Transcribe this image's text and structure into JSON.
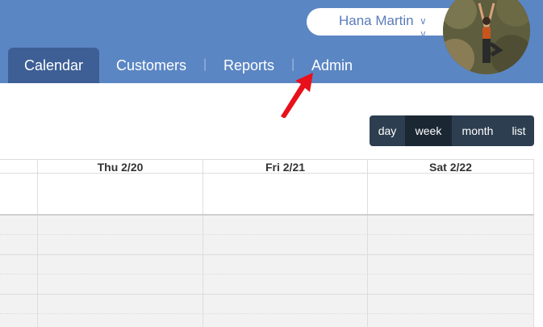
{
  "header": {
    "user_name": "Hana Martin",
    "user_menu_icon": "double-chevron-down-icon",
    "avatar": "profile-photo"
  },
  "nav": {
    "tabs": [
      {
        "label": "Calendar",
        "active": true
      },
      {
        "label": "Customers",
        "active": false
      },
      {
        "label": "Reports",
        "active": false
      },
      {
        "label": "Admin",
        "active": false
      }
    ],
    "separator": "|"
  },
  "view_switcher": {
    "buttons": [
      {
        "label": "day",
        "active": false
      },
      {
        "label": "week",
        "active": true
      },
      {
        "label": "month",
        "active": false
      },
      {
        "label": "list",
        "active": false
      }
    ]
  },
  "calendar": {
    "columns": [
      "Thu 2/20",
      "Fri 2/21",
      "Sat 2/22"
    ]
  },
  "annotation": {
    "pointer": "red-arrow-icon"
  },
  "colors": {
    "topbar": "#5b86c4",
    "active_tab": "#3d5f96",
    "view_switcher": "#2d3e50",
    "view_active": "#1b2733",
    "arrow": "#e8101a"
  }
}
